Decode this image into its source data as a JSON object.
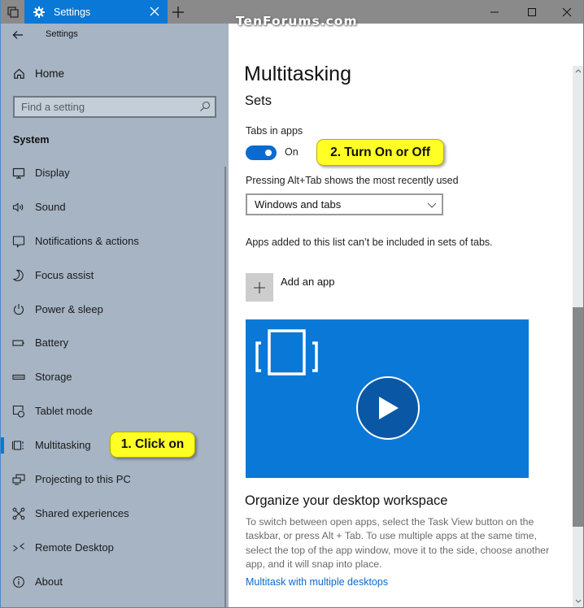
{
  "window": {
    "tab_title": "Settings",
    "watermark": "TenForums.com"
  },
  "sidebar": {
    "back_title": "Settings",
    "home_label": "Home",
    "search_placeholder": "Find a setting",
    "section_title": "System",
    "items": [
      {
        "label": "Display",
        "icon": "monitor-icon"
      },
      {
        "label": "Sound",
        "icon": "speaker-icon"
      },
      {
        "label": "Notifications & actions",
        "icon": "notification-icon"
      },
      {
        "label": "Focus assist",
        "icon": "moon-icon"
      },
      {
        "label": "Power & sleep",
        "icon": "power-icon"
      },
      {
        "label": "Battery",
        "icon": "battery-icon"
      },
      {
        "label": "Storage",
        "icon": "storage-icon"
      },
      {
        "label": "Tablet mode",
        "icon": "tablet-mode-icon"
      },
      {
        "label": "Multitasking",
        "icon": "multitasking-icon",
        "selected": true
      },
      {
        "label": "Projecting to this PC",
        "icon": "projecting-icon"
      },
      {
        "label": "Shared experiences",
        "icon": "shared-experiences-icon"
      },
      {
        "label": "Remote Desktop",
        "icon": "remote-desktop-icon"
      },
      {
        "label": "About",
        "icon": "info-icon"
      }
    ]
  },
  "main": {
    "title": "Multitasking",
    "section": "Sets",
    "tabs_in_apps_label": "Tabs in apps",
    "tabs_in_apps_state": "On",
    "tabs_in_apps_on": true,
    "alt_tab_label": "Pressing Alt+Tab shows the most recently used",
    "alt_tab_value": "Windows and tabs",
    "exclusion_note": "Apps added to this list can’t be included in sets of tabs.",
    "add_app_label": "Add an app",
    "organize_title": "Organize your desktop workspace",
    "organize_desc": "To switch between open apps, select the Task View button on the taskbar, or press Alt + Tab. To use multiple apps at the same time, select the top of the app window, move it to the side, choose another app, and it will snap into place.",
    "organize_link": "Multitask with multiple desktops"
  },
  "callouts": {
    "step1": "1. Click on",
    "step2": "2. Turn On or Off"
  },
  "colors": {
    "accent": "#0a78d7",
    "sidebar_bg": "#a6b4c3",
    "callout": "#ffff26",
    "link": "#0a6ad0"
  }
}
